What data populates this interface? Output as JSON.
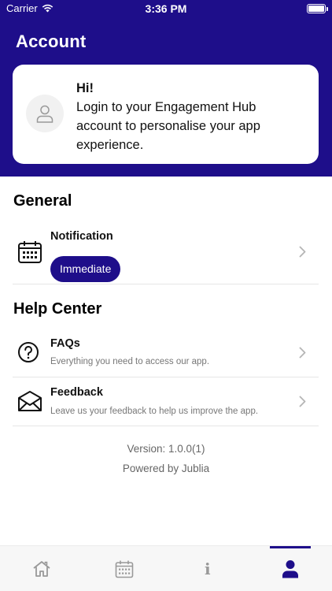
{
  "status": {
    "carrier": "Carrier",
    "time": "3:36 PM"
  },
  "header": {
    "title": "Account"
  },
  "login_card": {
    "greeting": "Hi!",
    "message": "Login to your Engagement Hub account to personalise your app experience."
  },
  "general": {
    "title": "General",
    "notification": {
      "label": "Notification",
      "value": "Immediate"
    }
  },
  "help_center": {
    "title": "Help Center",
    "items": [
      {
        "label": "FAQs",
        "subtitle": "Everything you need to access our app."
      },
      {
        "label": "Feedback",
        "subtitle": "Leave us your feedback to help us improve the app."
      }
    ]
  },
  "footer": {
    "version": "Version: 1.0.0(1)",
    "powered_by": "Powered by Jublia"
  },
  "tabbar": {
    "tabs": [
      {
        "icon": "home-icon"
      },
      {
        "icon": "calendar-icon"
      },
      {
        "icon": "info-icon"
      },
      {
        "icon": "profile-icon",
        "active": true
      }
    ]
  },
  "colors": {
    "brand": "#1e0e8a",
    "tab_inactive": "#999999"
  }
}
